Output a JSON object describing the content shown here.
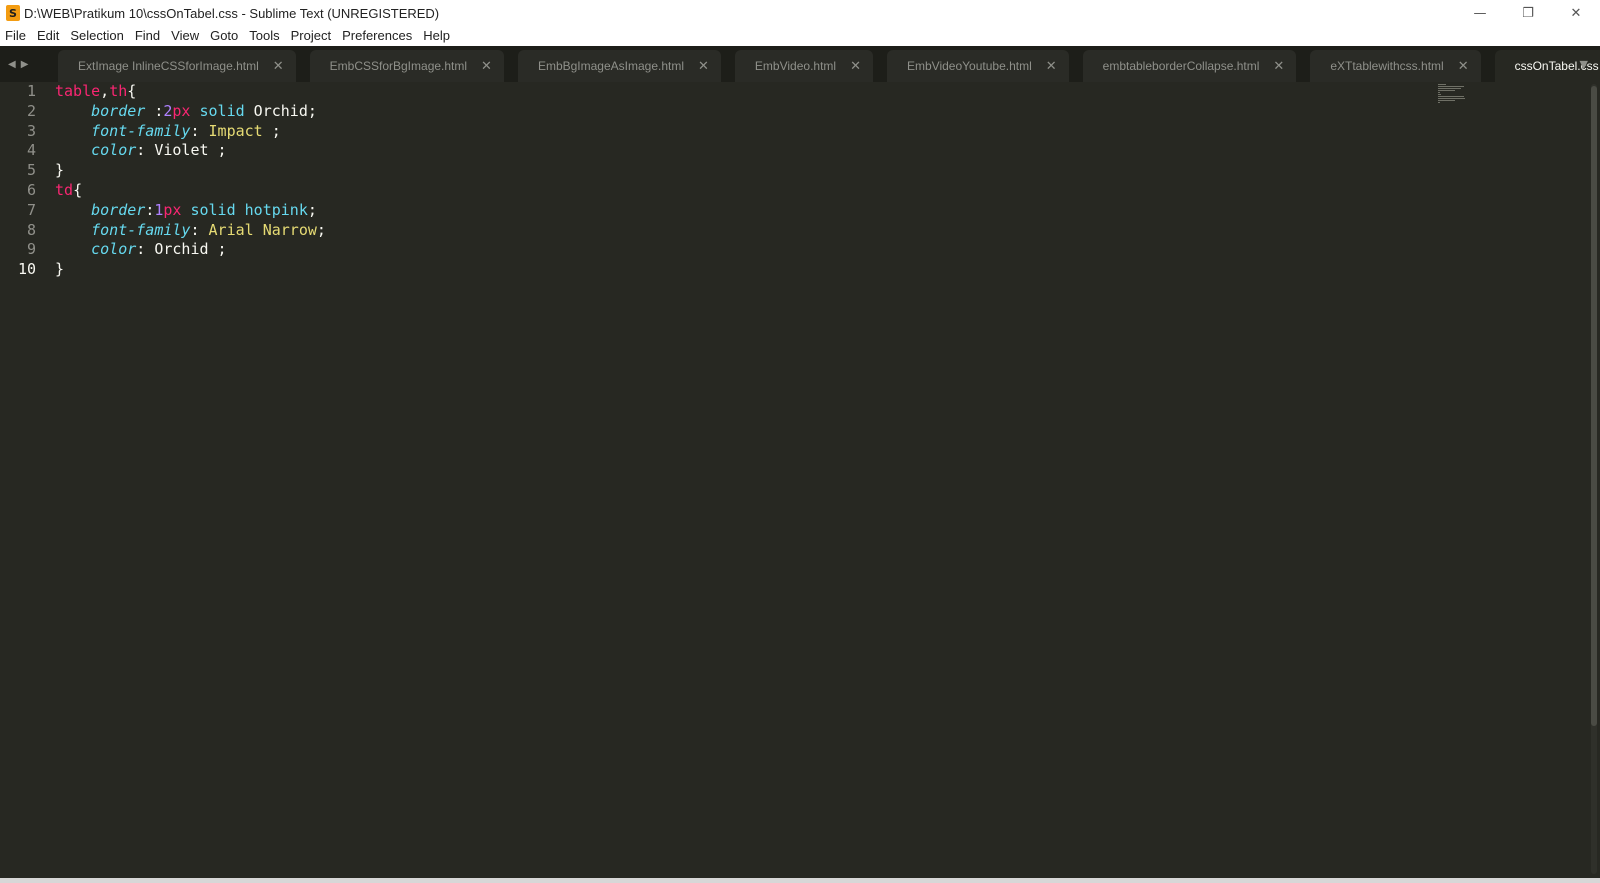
{
  "window": {
    "title": "D:\\WEB\\Pratikum 10\\cssOnTabel.css - Sublime Text (UNREGISTERED)",
    "app_icon_glyph": "S",
    "minimize_glyph": "—",
    "maximize_glyph": "❐",
    "close_glyph": "✕"
  },
  "menu": [
    "File",
    "Edit",
    "Selection",
    "Find",
    "View",
    "Goto",
    "Tools",
    "Project",
    "Preferences",
    "Help"
  ],
  "tab_nav": {
    "back_glyph": "◀",
    "forward_glyph": "▶",
    "dropdown_glyph": "▼"
  },
  "tabs": [
    {
      "label": "ExtImage   InlineCSSforImage.html",
      "active": false
    },
    {
      "label": "EmbCSSforBgImage.html",
      "active": false
    },
    {
      "label": "EmbBgImageAsImage.html",
      "active": false
    },
    {
      "label": "EmbVideo.html",
      "active": false
    },
    {
      "label": "EmbVideoYoutube.html",
      "active": false
    },
    {
      "label": "embtableborderCollapse.html",
      "active": false
    },
    {
      "label": "eXTtablewithcss.html",
      "active": false
    },
    {
      "label": "cssOnTabel.css",
      "active": true
    }
  ],
  "tab_close_glyph": "✕",
  "editor": {
    "current_line": 10,
    "lines": [
      {
        "num": "1",
        "tokens": [
          {
            "t": "table",
            "c": "tag"
          },
          {
            "t": ",",
            "c": "plain"
          },
          {
            "t": "th",
            "c": "tag"
          },
          {
            "t": "{",
            "c": "plain"
          }
        ]
      },
      {
        "num": "2",
        "tokens": [
          {
            "t": "    ",
            "c": "plain"
          },
          {
            "t": "border",
            "c": "prop"
          },
          {
            "t": " :",
            "c": "plain"
          },
          {
            "t": "2",
            "c": "num"
          },
          {
            "t": "px",
            "c": "unit"
          },
          {
            "t": " ",
            "c": "plain"
          },
          {
            "t": "solid",
            "c": "const"
          },
          {
            "t": " Orchid;",
            "c": "plain"
          }
        ]
      },
      {
        "num": "3",
        "tokens": [
          {
            "t": "    ",
            "c": "plain"
          },
          {
            "t": "font-family",
            "c": "prop"
          },
          {
            "t": ": ",
            "c": "plain"
          },
          {
            "t": "Impact",
            "c": "str"
          },
          {
            "t": " ;",
            "c": "plain"
          }
        ]
      },
      {
        "num": "4",
        "tokens": [
          {
            "t": "    ",
            "c": "plain"
          },
          {
            "t": "color",
            "c": "prop"
          },
          {
            "t": ": Violet ;",
            "c": "plain"
          }
        ]
      },
      {
        "num": "5",
        "tokens": [
          {
            "t": "}",
            "c": "plain"
          }
        ]
      },
      {
        "num": "6",
        "tokens": [
          {
            "t": "td",
            "c": "tag"
          },
          {
            "t": "{",
            "c": "plain"
          }
        ]
      },
      {
        "num": "7",
        "tokens": [
          {
            "t": "    ",
            "c": "plain"
          },
          {
            "t": "border",
            "c": "prop"
          },
          {
            "t": ":",
            "c": "plain"
          },
          {
            "t": "1",
            "c": "num"
          },
          {
            "t": "px",
            "c": "unit"
          },
          {
            "t": " ",
            "c": "plain"
          },
          {
            "t": "solid",
            "c": "const"
          },
          {
            "t": " ",
            "c": "plain"
          },
          {
            "t": "hotpink",
            "c": "const"
          },
          {
            "t": ";",
            "c": "plain"
          }
        ]
      },
      {
        "num": "8",
        "tokens": [
          {
            "t": "    ",
            "c": "plain"
          },
          {
            "t": "font-family",
            "c": "prop"
          },
          {
            "t": ": ",
            "c": "plain"
          },
          {
            "t": "Arial Narrow",
            "c": "str"
          },
          {
            "t": ";",
            "c": "plain"
          }
        ]
      },
      {
        "num": "9",
        "tokens": [
          {
            "t": "    ",
            "c": "plain"
          },
          {
            "t": "color",
            "c": "prop"
          },
          {
            "t": ": Orchid ;",
            "c": "plain"
          }
        ]
      },
      {
        "num": "10",
        "tokens": [
          {
            "t": "}",
            "c": "plain"
          }
        ]
      }
    ]
  },
  "colors": {
    "editor_bg": "#272822",
    "tabbar_bg": "#1d1e19",
    "keyword": "#f92672",
    "property": "#66d9ef",
    "string": "#e6db74",
    "number": "#ae81ff",
    "text": "#f8f8f2"
  }
}
